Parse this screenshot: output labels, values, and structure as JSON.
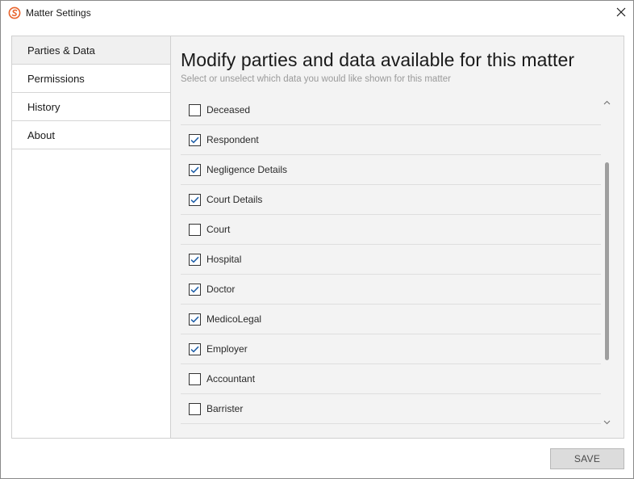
{
  "window": {
    "title": "Matter Settings",
    "accent_color": "#e8632b"
  },
  "sidebar": {
    "items": [
      {
        "label": "Parties & Data",
        "active": true
      },
      {
        "label": "Permissions",
        "active": false
      },
      {
        "label": "History",
        "active": false
      },
      {
        "label": "About",
        "active": false
      }
    ]
  },
  "main": {
    "heading": "Modify parties and data available for this matter",
    "subheading": "Select or unselect which data you would like shown for this matter",
    "items": [
      {
        "label": "Deceased",
        "checked": false
      },
      {
        "label": "Respondent",
        "checked": true
      },
      {
        "label": "Negligence Details",
        "checked": true
      },
      {
        "label": "Court Details",
        "checked": true
      },
      {
        "label": "Court",
        "checked": false
      },
      {
        "label": "Hospital",
        "checked": true
      },
      {
        "label": "Doctor",
        "checked": true
      },
      {
        "label": "MedicoLegal",
        "checked": true
      },
      {
        "label": "Employer",
        "checked": true
      },
      {
        "label": "Accountant",
        "checked": false
      },
      {
        "label": "Barrister",
        "checked": false
      }
    ],
    "check_color": "#1f5fa8"
  },
  "footer": {
    "save_label": "SAVE"
  }
}
